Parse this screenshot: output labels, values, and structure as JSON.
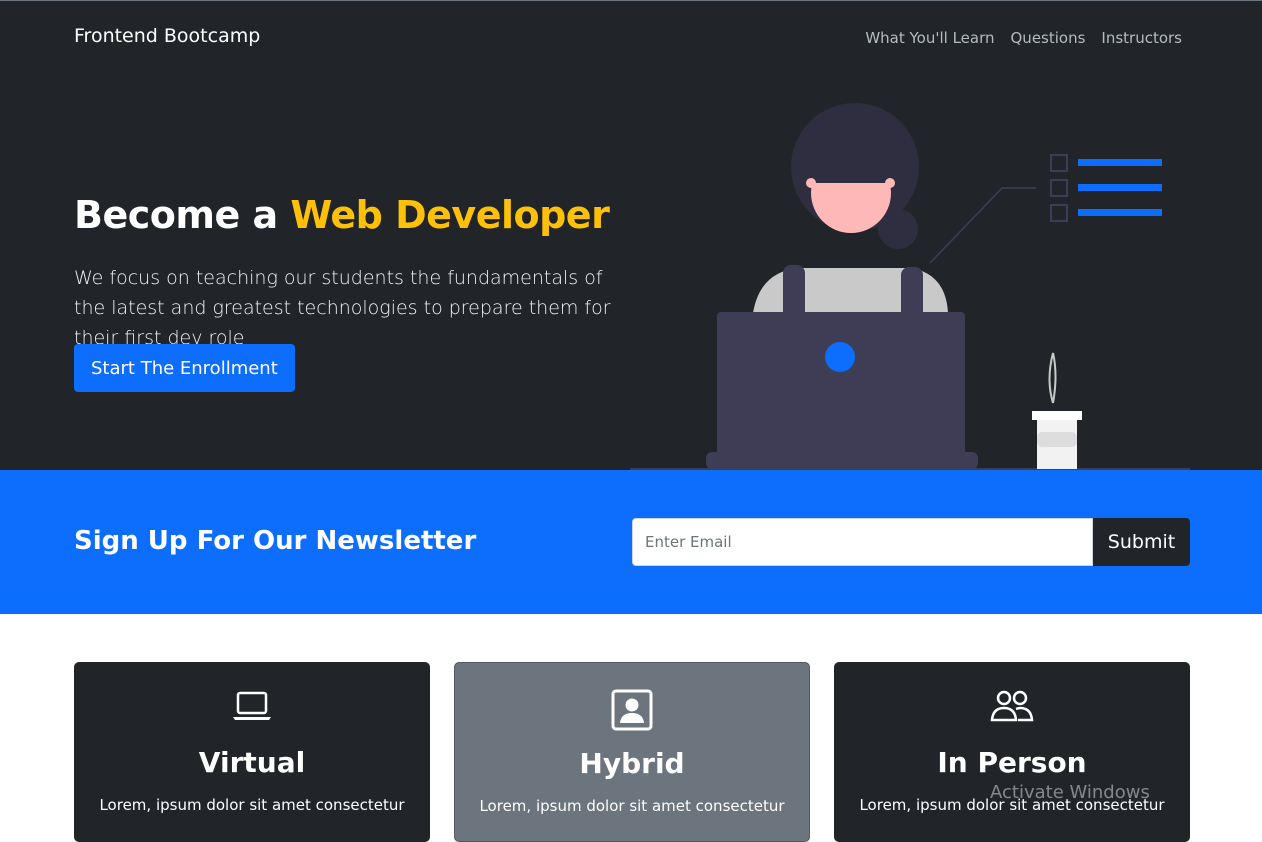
{
  "navbar": {
    "brand": "Frontend Bootcamp",
    "links": [
      "What You'll Learn",
      "Questions",
      "Instructors"
    ]
  },
  "hero": {
    "title_prefix": "Become a ",
    "title_accent": "Web Developer",
    "lead": "We focus on teaching our students the fundamentals of the latest and greatest technologies to prepare them for their first dev role",
    "cta_label": "Start The Enrollment"
  },
  "newsletter": {
    "heading": "Sign Up For Our Newsletter",
    "email_placeholder": "Enter Email",
    "email_value": "",
    "submit_label": "Submit"
  },
  "boxes": [
    {
      "icon": "laptop-icon",
      "title": "Virtual",
      "text": "Lorem, ipsum dolor sit amet consectetur"
    },
    {
      "icon": "person-badge-icon",
      "title": "Hybrid",
      "text": "Lorem, ipsum dolor sit amet consectetur"
    },
    {
      "icon": "people-icon",
      "title": "In Person",
      "text": "Lorem, ipsum dolor sit amet consectetur"
    }
  ],
  "os_watermark": "Activate Windows",
  "colors": {
    "dark": "#212529",
    "primary": "#0d6efd",
    "warning": "#ffc107",
    "secondary": "#6c757d"
  }
}
